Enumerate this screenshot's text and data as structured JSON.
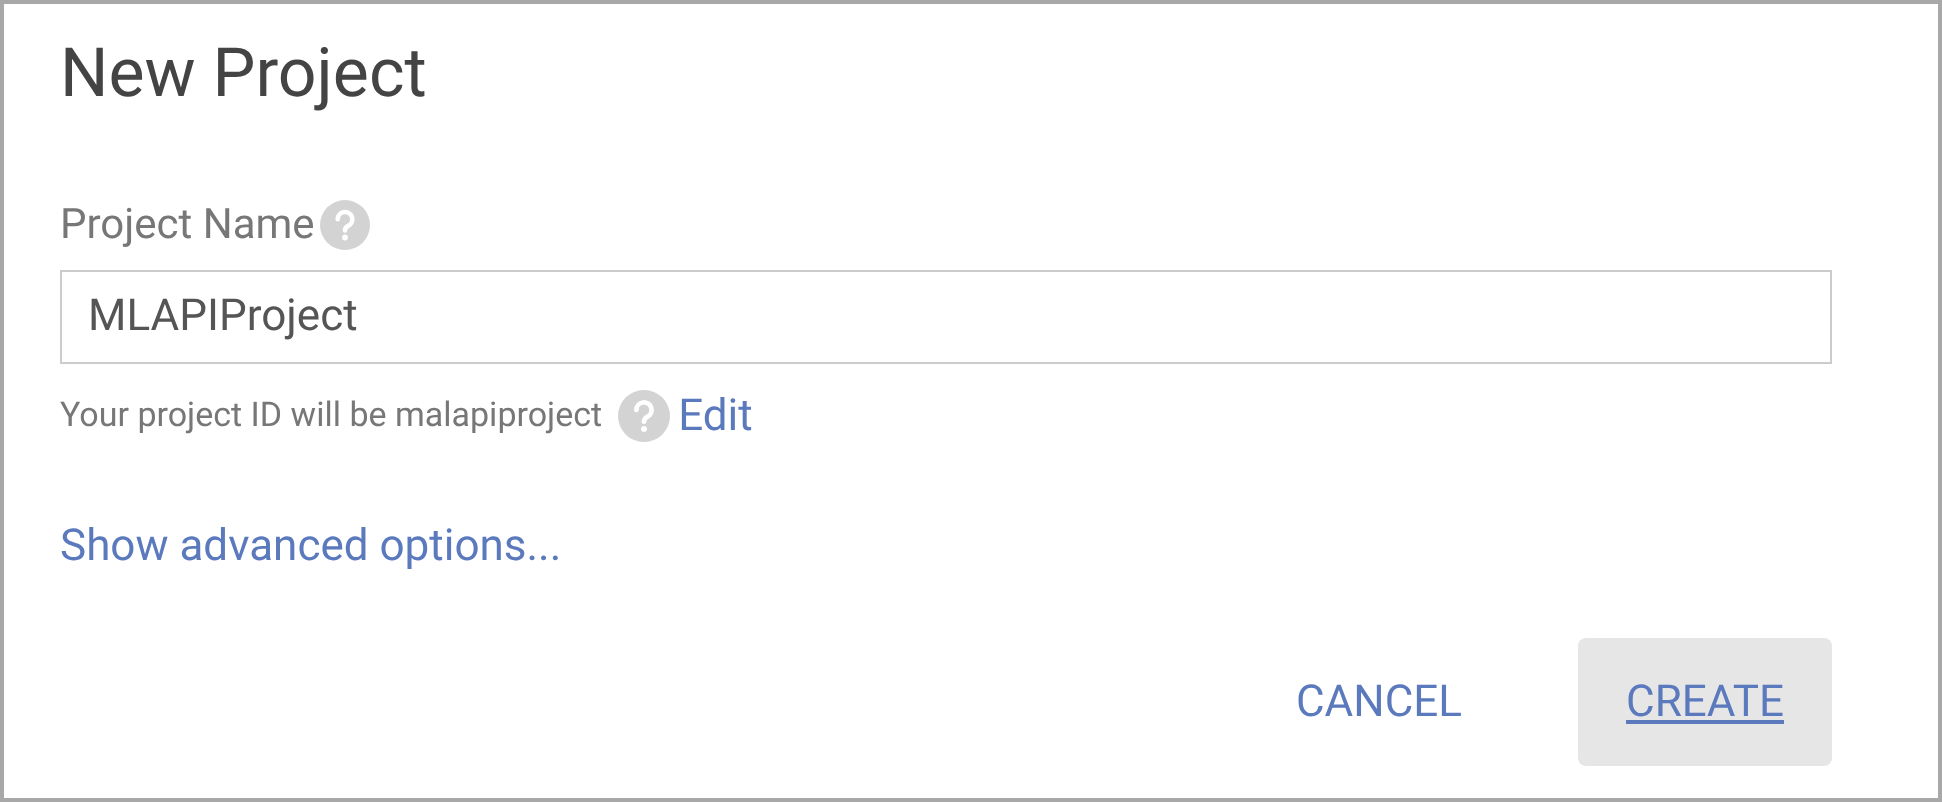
{
  "dialog": {
    "title": "New Project",
    "field": {
      "label": "Project Name",
      "value": "MLAPIProject"
    },
    "hint": {
      "text": "Your project ID will be malapiproject",
      "link": "Edit"
    },
    "advanced_link": "Show advanced options...",
    "buttons": [
      {
        "label": "CANCEL",
        "focused": false
      },
      {
        "label": "CREATE",
        "focused": true
      }
    ]
  }
}
